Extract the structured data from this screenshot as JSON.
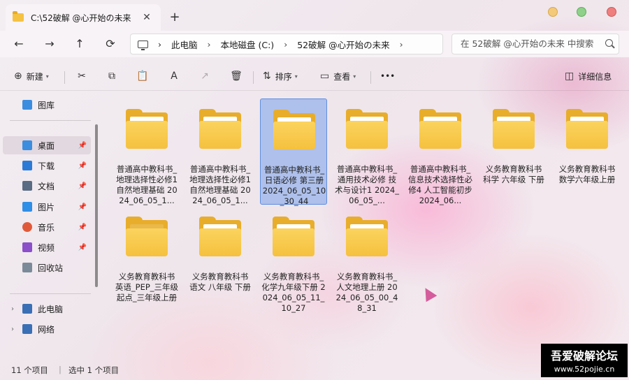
{
  "window": {
    "tab_title": "C:\\52破解 @心开始の未来",
    "tab_close": "✕",
    "new_tab": "+"
  },
  "nav": {
    "back": "←",
    "forward": "→",
    "up": "↑",
    "refresh": "⟳"
  },
  "breadcrumb": {
    "sep": "›",
    "items": [
      "此电脑",
      "本地磁盘 (C:)",
      "52破解 @心开始の未来"
    ]
  },
  "search": {
    "placeholder": "在 52破解 @心开始の未来 中搜索"
  },
  "toolbar": {
    "new_label": "新建",
    "sort_label": "排序",
    "view_label": "查看",
    "more": "•••",
    "details_label": "详细信息",
    "icons": {
      "cut": "✂",
      "copy": "⧉",
      "paste": "📋",
      "rename": "A",
      "share": "↗",
      "delete": "🗑"
    }
  },
  "sidebar": {
    "gallery": "图库",
    "quick_access": [
      {
        "label": "桌面",
        "icon": "desktop-icon",
        "color": "#3b8de0",
        "selected": true
      },
      {
        "label": "下载",
        "icon": "download-icon",
        "color": "#2b7bd6"
      },
      {
        "label": "文档",
        "icon": "document-icon",
        "color": "#5a6b84"
      },
      {
        "label": "图片",
        "icon": "picture-icon",
        "color": "#2f8ee6"
      },
      {
        "label": "音乐",
        "icon": "music-icon",
        "color": "#e05a3a"
      },
      {
        "label": "视频",
        "icon": "video-icon",
        "color": "#8a4fc9"
      },
      {
        "label": "回收站",
        "icon": "recycle-bin-icon",
        "color": "#7b8a99"
      }
    ],
    "pin": "📌",
    "this_pc": "此电脑",
    "network": "网络",
    "chevron": "›"
  },
  "files": [
    {
      "name": "普通高中教科书_地理选择性必修1 自然地理基础 2024_06_05_1..."
    },
    {
      "name": "普通高中教科书_地理选择性必修1 自然地理基础 2024_06_05_1..."
    },
    {
      "name": "普通高中教科书_日语必修 第三册 2024_06_05_10_30_44",
      "selected": true
    },
    {
      "name": "普通高中教科书_通用技术必修 技术与设计1 2024_06_05_..."
    },
    {
      "name": "普通高中教科书_信息技术选择性必修4 人工智能初步 2024_06..."
    },
    {
      "name": "义务教育教科书 科学 六年级 下册"
    },
    {
      "name": "义务教育教科书 数学六年级上册"
    },
    {
      "name": "义务教育教科书 英语_PEP_三年级起点_三年级上册"
    },
    {
      "name": "义务教育教科书 语文 八年级 下册"
    },
    {
      "name": "义务教育教科书_化学九年级下册 2024_06_05_11_10_27"
    },
    {
      "name": "义务教育教科书_人文地理上册 2024_06_05_00_48_31"
    }
  ],
  "status": {
    "count": "11 个项目",
    "selected": "选中 1 个项目"
  },
  "watermark": {
    "line1": "吾爱破解论坛",
    "line2": "www.52pojie.cn"
  }
}
